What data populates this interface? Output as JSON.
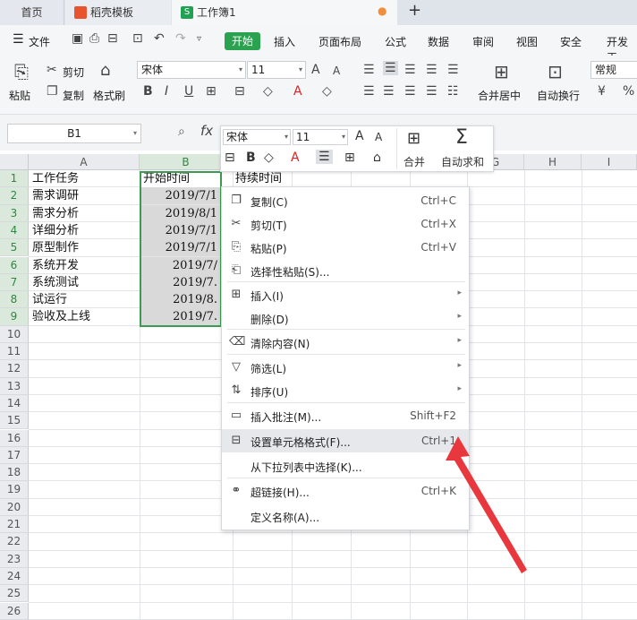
{
  "tabs": {
    "home": "首页",
    "template": "稻壳模板",
    "book": "工作簿1",
    "book_icon": "S"
  },
  "menubar": {
    "file": "文件",
    "start": "开始",
    "items": [
      "插入",
      "页面布局",
      "公式",
      "数据",
      "审阅",
      "视图",
      "安全",
      "开发工"
    ]
  },
  "ribbon": {
    "paste": "粘贴",
    "cut": "剪切",
    "copy": "复制",
    "format_painter": "格式刷",
    "font_name": "宋体",
    "font_size": "11",
    "merge_center": "合并居中",
    "wrap_text": "自动换行",
    "number_format": "常规",
    "bold": "B",
    "italic": "I",
    "underline": "U"
  },
  "formula_bar": {
    "name_box": "B1",
    "fx": "fx"
  },
  "grid": {
    "columns": [
      "A",
      "B",
      "C",
      "D",
      "E",
      "F",
      "G",
      "H",
      "I"
    ],
    "rows": [
      "1",
      "2",
      "3",
      "4",
      "5",
      "6",
      "7",
      "8",
      "9",
      "10",
      "11",
      "12",
      "13",
      "14",
      "15",
      "16",
      "17",
      "18",
      "19",
      "20",
      "21",
      "22",
      "23",
      "24",
      "25",
      "26"
    ],
    "colA": [
      "工作任务",
      "需求调研",
      "需求分析",
      "详细分析",
      "原型制作",
      "系统开发",
      "系统测试",
      "试运行",
      "验收及上线"
    ],
    "colB": [
      "开始时间",
      "2019/7/1",
      "2019/8/1",
      "2019/7/1",
      "2019/7/1",
      "2019/7/",
      "2019/7.",
      "2019/8.",
      "2019/7."
    ],
    "c1": "持续时间"
  },
  "mini_toolbar": {
    "font_name": "宋体",
    "font_size": "11",
    "bold": "B",
    "merge": "合并",
    "autosum": "自动求和"
  },
  "context_menu": {
    "items": [
      {
        "label": "复制(C)",
        "shortcut": "Ctrl+C",
        "icon": "copy-icon"
      },
      {
        "label": "剪切(T)",
        "shortcut": "Ctrl+X",
        "icon": "scissors-icon"
      },
      {
        "label": "粘贴(P)",
        "shortcut": "Ctrl+V",
        "icon": "paste-icon"
      },
      {
        "label": "选择性粘贴(S)...",
        "shortcut": "",
        "icon": "paste-special-icon"
      },
      {
        "label": "插入(I)",
        "shortcut": "",
        "icon": "insert-icon"
      },
      {
        "label": "删除(D)",
        "shortcut": "",
        "icon": ""
      },
      {
        "label": "清除内容(N)",
        "shortcut": "",
        "icon": "eraser-icon"
      },
      {
        "label": "筛选(L)",
        "shortcut": "",
        "icon": "filter-icon"
      },
      {
        "label": "排序(U)",
        "shortcut": "",
        "icon": "sort-icon"
      },
      {
        "label": "插入批注(M)...",
        "shortcut": "Shift+F2",
        "icon": "comment-icon"
      },
      {
        "label": "设置单元格格式(F)...",
        "shortcut": "Ctrl+1",
        "icon": "format-cells-icon"
      },
      {
        "label": "从下拉列表中选择(K)...",
        "shortcut": "",
        "icon": ""
      },
      {
        "label": "超链接(H)...",
        "shortcut": "Ctrl+K",
        "icon": "link-icon"
      },
      {
        "label": "定义名称(A)...",
        "shortcut": "",
        "icon": ""
      }
    ]
  },
  "colors": {
    "accent_green": "#2aa250",
    "selection_green": "#3d9a52",
    "arrow_red": "#e8383d"
  }
}
